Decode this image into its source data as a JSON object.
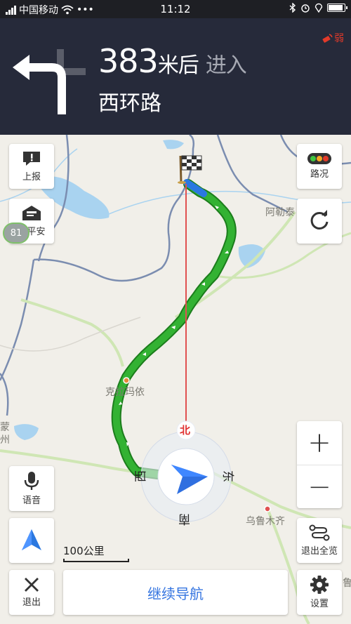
{
  "status_bar": {
    "carrier": "中国移动",
    "dots": "•••",
    "time": "11:12"
  },
  "navigation": {
    "distance_value": "383",
    "distance_unit": "米后",
    "action": "进入",
    "road_name": "西环路",
    "gps_signal": "弱"
  },
  "map": {
    "labels": {
      "city_1": "克拉玛依",
      "city_2": "乌鲁木齐",
      "place_1": "阿勒泰",
      "edge_left": "蒙",
      "edge_left_2": "州",
      "edge_right": "鲁"
    },
    "compass": {
      "north": "北",
      "east": "东",
      "south": "南",
      "west": "西"
    },
    "scale": "100公里",
    "badge": "81"
  },
  "buttons": {
    "report": "上报",
    "safe": "报平安",
    "traffic": "路况",
    "voice": "语音",
    "exit": "退出",
    "overview": "退出全览",
    "settings": "设置",
    "continue": "继续导航",
    "zoom_in": "+",
    "zoom_out": "−"
  },
  "colors": {
    "route": "#2fae2f",
    "accent": "#3575e0",
    "header_bg": "#262a3a",
    "weak_signal": "#e23a2a"
  }
}
